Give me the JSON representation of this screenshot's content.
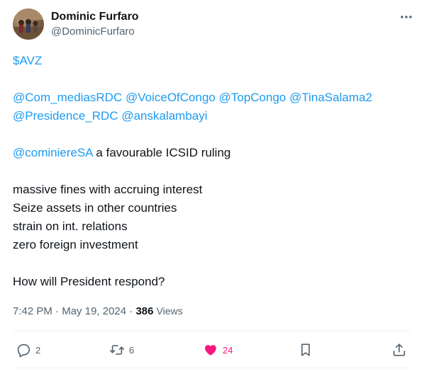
{
  "user": {
    "display_name": "Dominic Furfaro",
    "handle": "@DominicFurfaro",
    "avatar_icon": "profile-photo"
  },
  "tweet": {
    "cashtag": "$AVZ",
    "mentions_line1": [
      "@Com_mediasRDC",
      "@VoiceOfCongo",
      "@TopCongo",
      "@TinaSalama2"
    ],
    "mentions_line2": [
      "@Presidence_RDC",
      "@anskalambayi"
    ],
    "ruling_mention": "@cominiereSA",
    "ruling_text": " a favourable ICSID ruling",
    "consequences": [
      "massive fines with accruing interest",
      "Seize assets in other countries",
      "strain on int. relations",
      "zero foreign investment"
    ],
    "question": "How will President respond?"
  },
  "meta": {
    "time": "7:42 PM",
    "separator": " · ",
    "date": "May 19, 2024",
    "views_count": "386",
    "views_label": "Views"
  },
  "actions": {
    "replies": "2",
    "reposts": "6",
    "likes": "24"
  },
  "colors": {
    "link": "#1d9bf0",
    "text": "#0f1419",
    "secondary": "#536471",
    "like": "#f91880",
    "divider": "#eff3f4"
  }
}
